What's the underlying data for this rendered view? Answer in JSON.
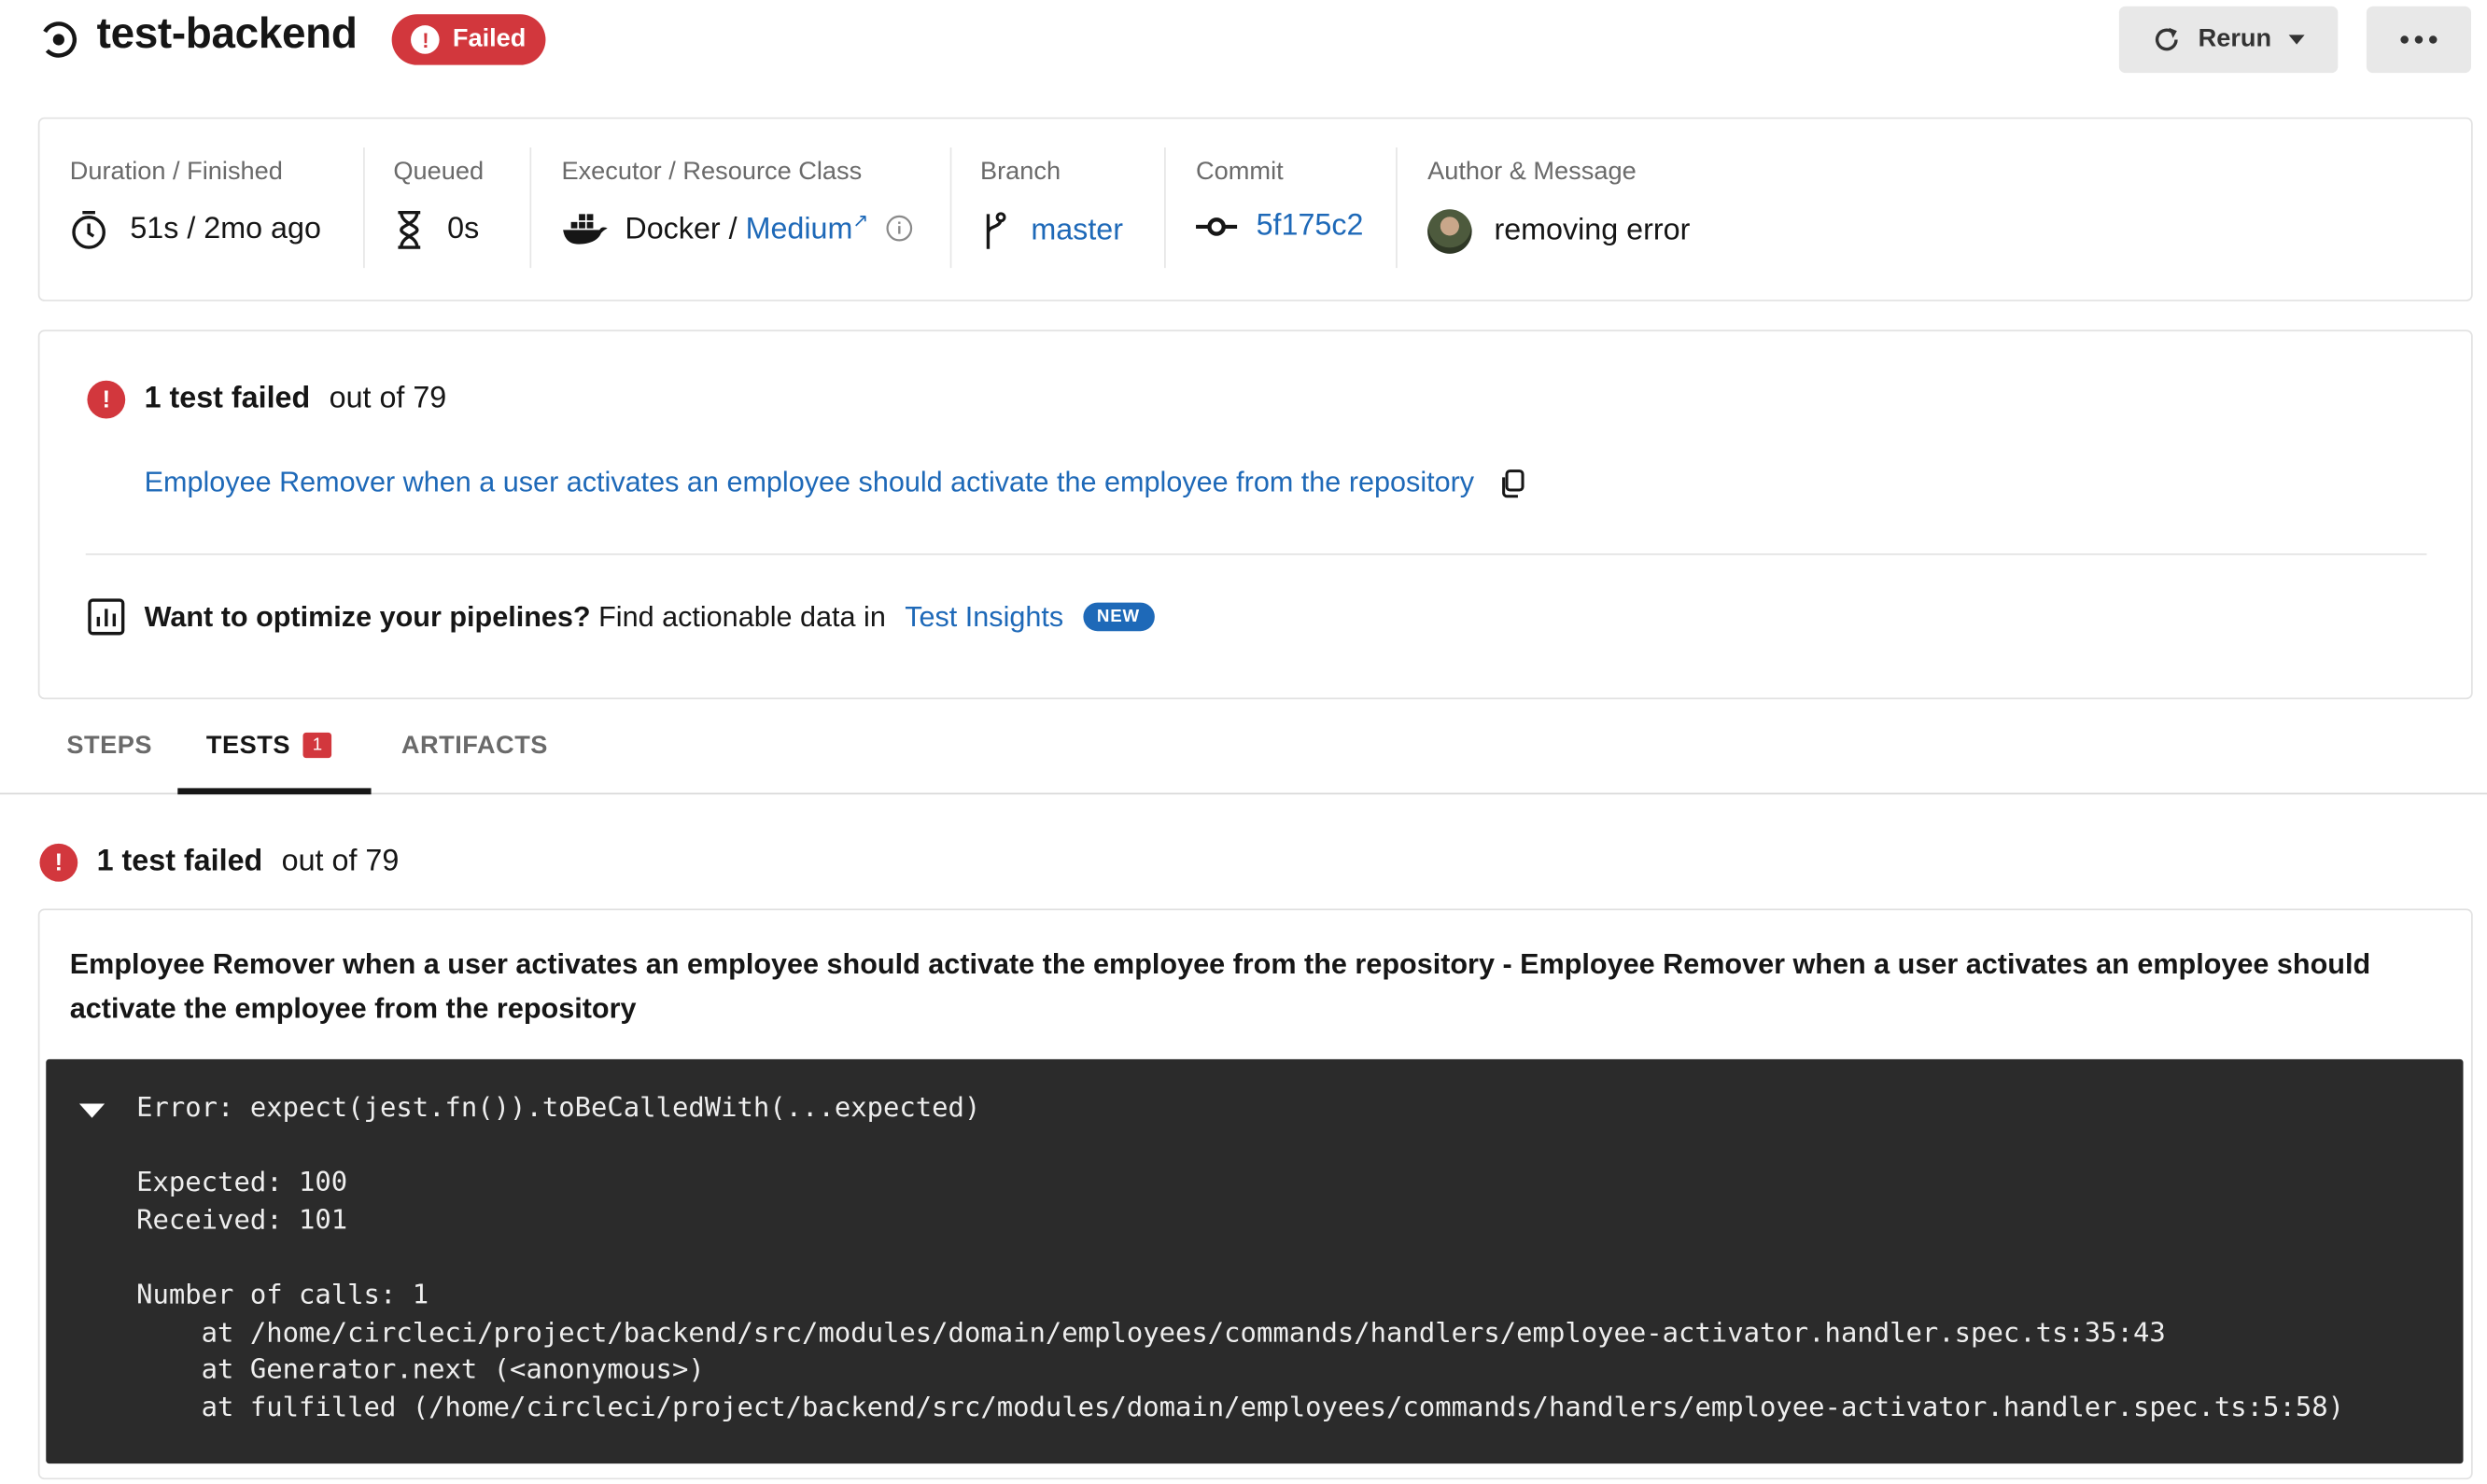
{
  "job": {
    "title": "test-backend",
    "status": "Failed",
    "status_color": "#d2373d",
    "rerun_label": "Rerun",
    "more_icon": "ellipsis-icon"
  },
  "info": {
    "duration_label": "Duration / Finished",
    "duration_value": "51s / 2mo ago",
    "queued_label": "Queued",
    "queued_value": "0s",
    "executor_label": "Executor / Resource Class",
    "executor_value": "Docker /",
    "resource_class": "Medium",
    "branch_label": "Branch",
    "branch_value": "master",
    "commit_label": "Commit",
    "commit_value": "5f175c2",
    "author_label": "Author & Message",
    "author_message": "removing error"
  },
  "summary": {
    "failed_text": "1 test failed",
    "out_of_text": "out of 79",
    "failed_test_link": "Employee Remover when a user activates an employee should activate the employee from the repository",
    "insights_bold": "Want to optimize your pipelines?",
    "insights_text": "Find actionable data in",
    "insights_link": "Test Insights",
    "new_badge": "NEW"
  },
  "tabs": [
    {
      "label": "STEPS"
    },
    {
      "label": "TESTS",
      "count": "1"
    },
    {
      "label": "ARTIFACTS"
    }
  ],
  "results": {
    "failed_text": "1 test failed",
    "out_of_text": "out of 79",
    "test_title": "Employee Remover when a user activates an employee should activate the employee from the repository - Employee Remover when a user activates an employee should activate the employee from the repository",
    "error_output": "Error: expect(jest.fn()).toBeCalledWith(...expected)\n\nExpected: 100\nReceived: 101\n\nNumber of calls: 1\n    at /home/circleci/project/backend/src/modules/domain/employees/commands/handlers/employee-activator.handler.spec.ts:35:43\n    at Generator.next (<anonymous>)\n    at fulfilled (/home/circleci/project/backend/src/modules/domain/employees/commands/handlers/employee-activator.handler.spec.ts:5:58)"
  }
}
